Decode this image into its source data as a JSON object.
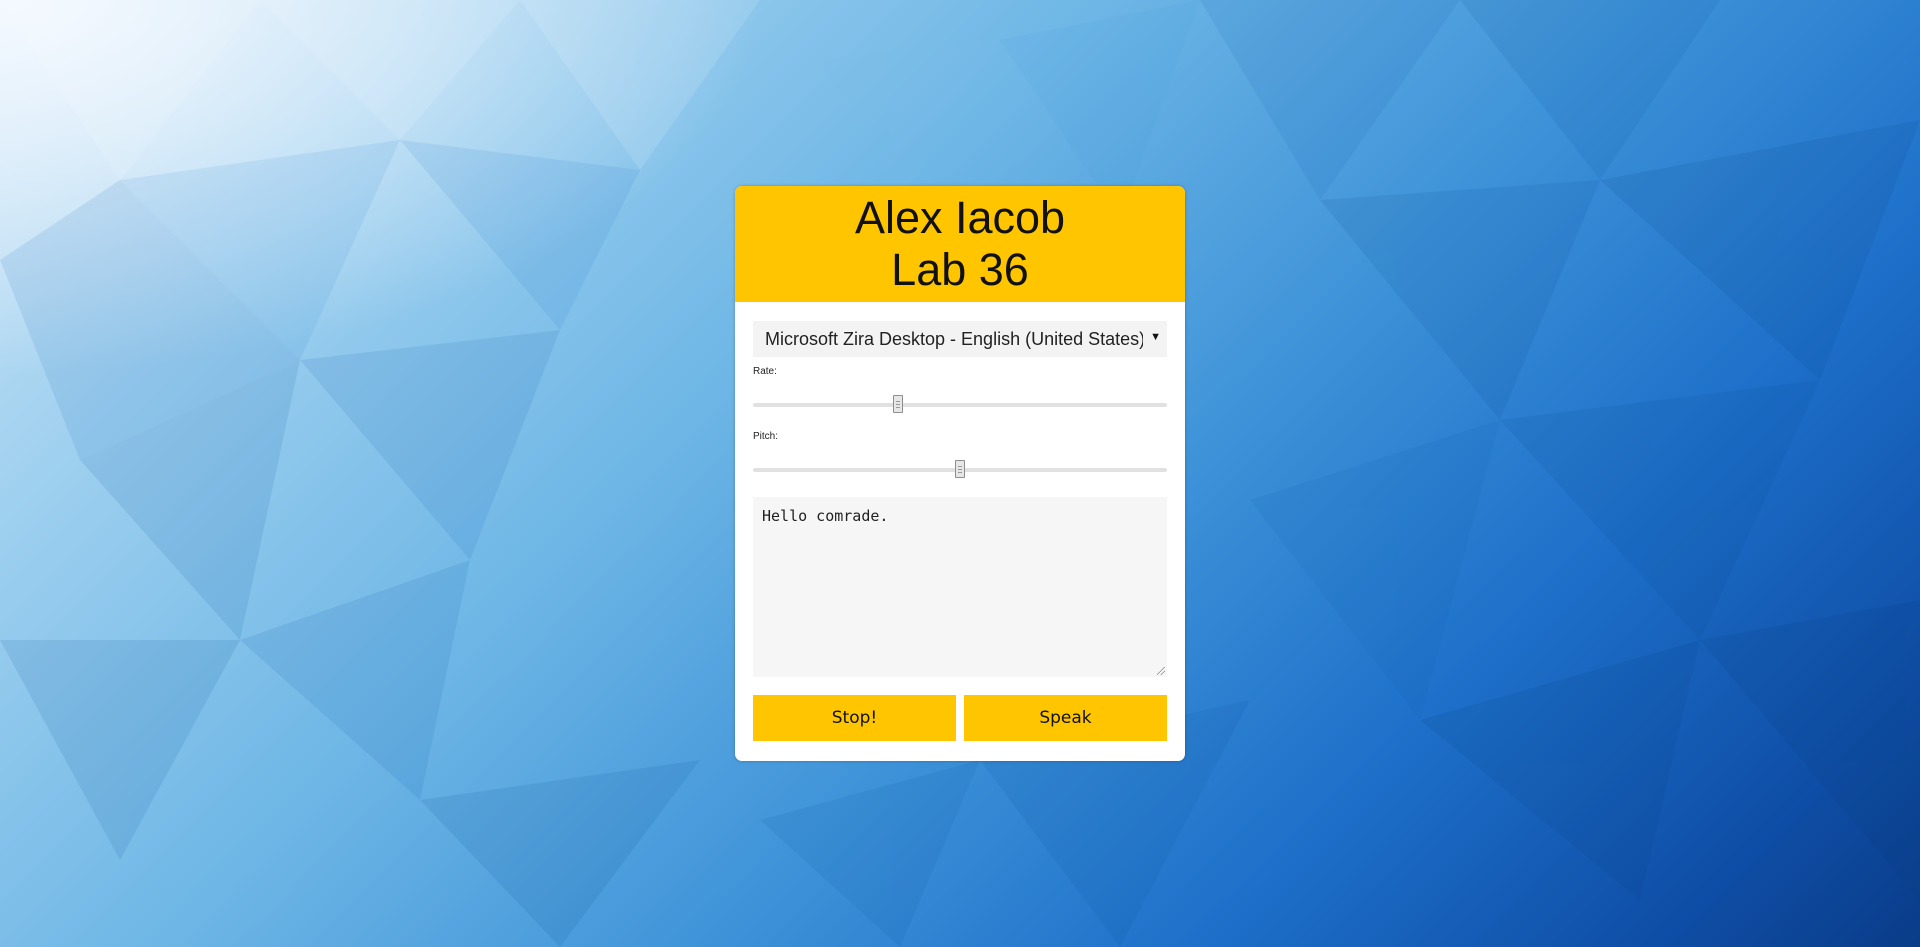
{
  "header": {
    "title_line1": "Alex Iacob",
    "title_line2": "Lab 36"
  },
  "voice_select": {
    "selected": "Microsoft Zira Desktop - English (United States)"
  },
  "rate": {
    "label": "Rate:",
    "value": 0.35
  },
  "pitch": {
    "label": "Pitch:",
    "value": 0.5
  },
  "message": {
    "text": "Hello comrade."
  },
  "buttons": {
    "stop_label": "Stop!",
    "speak_label": "Speak"
  },
  "colors": {
    "accent": "#ffc600",
    "panel": "#ffffff",
    "input_bg": "#f3f3f3"
  }
}
